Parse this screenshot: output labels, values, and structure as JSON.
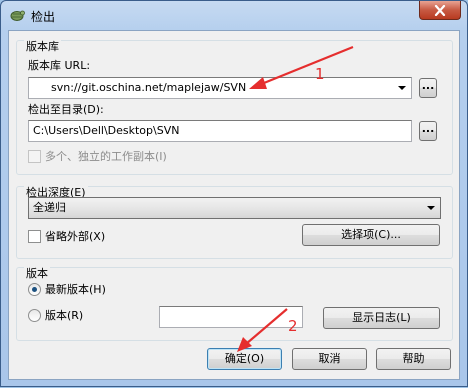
{
  "window": {
    "title": "检出"
  },
  "repository": {
    "group_title": "版本库",
    "url_label": "版本库 URL:",
    "url_value": "svn://git.oschina.net/maplejaw/SVN",
    "browse_label": "...",
    "dir_label": "检出至目录(D):",
    "dir_value": "C:\\Users\\Dell\\Desktop\\SVN",
    "dir_browse_label": "...",
    "multiple_label": "多个、独立的工作副本(I)"
  },
  "depth": {
    "group_title": "检出深度(E)",
    "selected": "全递归",
    "omit_externals_label": "省略外部(X)",
    "options_button": "选择项(C)..."
  },
  "revision": {
    "group_title": "版本",
    "head_label": "最新版本(H)",
    "revision_label": "版本(R)",
    "revision_value": "",
    "show_log_button": "显示日志(L)"
  },
  "footer": {
    "ok_button": "确定(O)",
    "cancel_button": "取消",
    "help_button": "帮助"
  },
  "annotations": {
    "arrow1_label": "1",
    "arrow2_label": "2"
  },
  "colors": {
    "annotation": "#e52e2e",
    "title_bar": "#b5cfee",
    "dialog_bg": "#f0f0f0"
  }
}
